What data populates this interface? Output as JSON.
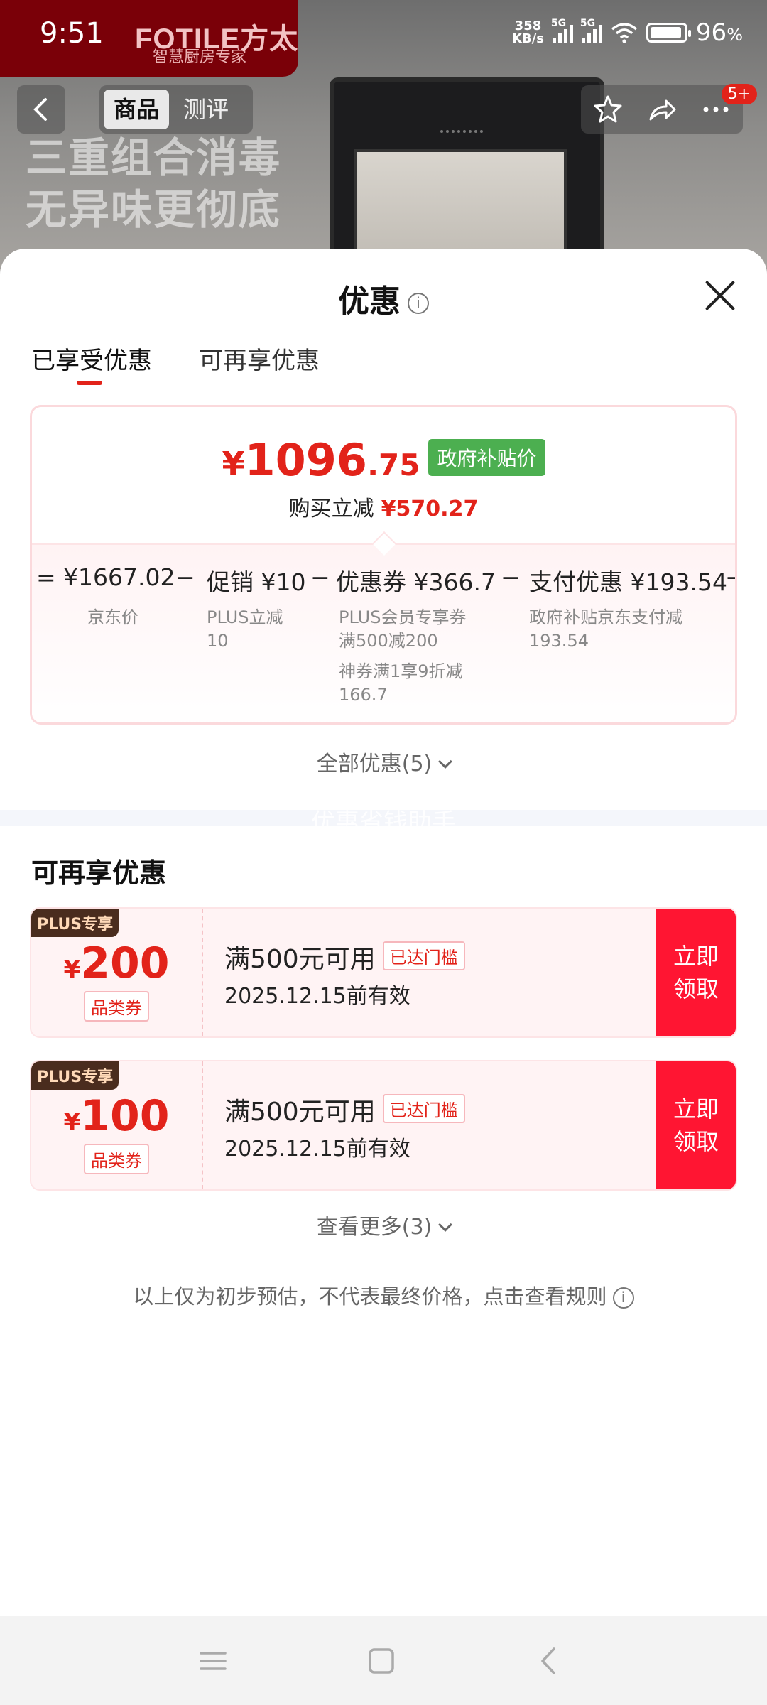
{
  "status_bar": {
    "time": "9:51",
    "net_speed_top": "358",
    "net_speed_bottom": "KB/s",
    "sig1": "5G",
    "sig2": "5G",
    "battery": "96",
    "battery_unit": "%"
  },
  "background": {
    "brand": "FOTILE方太",
    "brand_sub": "智慧厨房专家",
    "promo_line1": "三重组合消毒",
    "promo_line2": "无异味更彻底"
  },
  "nav": {
    "tabs": [
      "商品",
      "测评"
    ],
    "more_badge": "5+"
  },
  "sheet": {
    "title": "优惠",
    "tabs": [
      "已享受优惠",
      "可再享优惠"
    ],
    "summary": {
      "currency": "¥",
      "price_int": "1096",
      "price_dec": ".75",
      "price_tag": "政府补贴价",
      "reduce_label": "购买立减",
      "reduce_value": "¥570.27",
      "breakdown": [
        {
          "op": "=",
          "amount": "¥1667.02",
          "desc": [
            "京东价"
          ]
        },
        {
          "op": "−",
          "amount": "促销 ¥10",
          "desc": [
            "PLUS立减",
            "10"
          ]
        },
        {
          "op": "−",
          "amount": "优惠券 ¥366.7",
          "desc": [
            "PLUS会员专享券",
            "满500减200",
            "神券满1享9折减",
            "166.7"
          ]
        },
        {
          "op": "−",
          "amount": "支付优惠 ¥193.54",
          "desc": [
            "政府补贴京东支付减",
            "193.54"
          ]
        },
        {
          "op": "−"
        }
      ]
    },
    "all_discounts": "全部优惠(5)",
    "watermark": "优惠省钱助手",
    "section_title": "可再享优惠",
    "coupons": [
      {
        "badge": "PLUS专享",
        "currency": "¥",
        "amount": "200",
        "category": "品类券",
        "condition": "满500元可用",
        "reached": "已达门槛",
        "valid": "2025.12.15前有效",
        "claim_line1": "立即",
        "claim_line2": "领取"
      },
      {
        "badge": "PLUS专享",
        "currency": "¥",
        "amount": "100",
        "category": "品类券",
        "condition": "满500元可用",
        "reached": "已达门槛",
        "valid": "2025.12.15前有效",
        "claim_line1": "立即",
        "claim_line2": "领取"
      }
    ],
    "see_more": "查看更多(3)",
    "disclaimer": "以上仅为初步预估，不代表最终价格，点击查看规则"
  },
  "colors": {
    "accent_red": "#e2231a",
    "claim_red": "#ff1532",
    "gov_green": "#4caf50"
  }
}
